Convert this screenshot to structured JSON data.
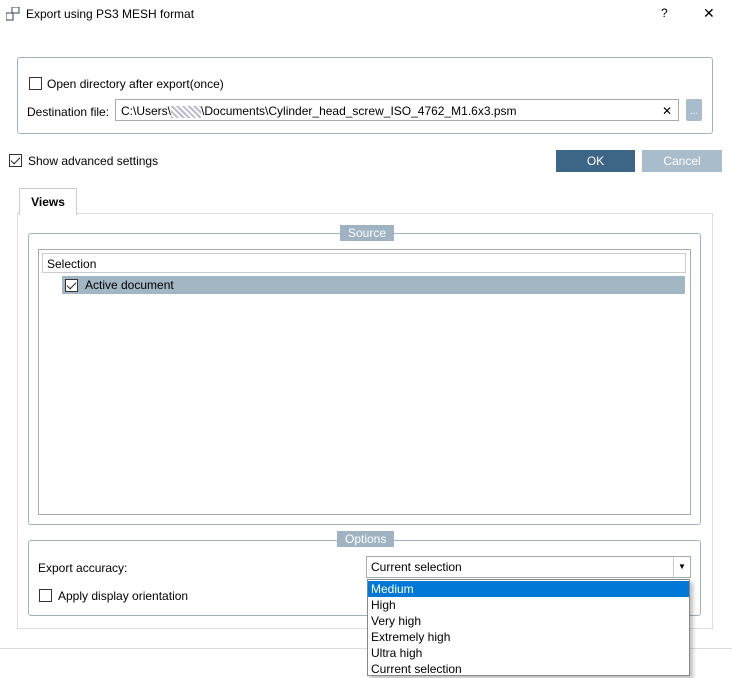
{
  "window": {
    "title": "Export using PS3 MESH format",
    "help": "?",
    "close": "✕"
  },
  "top": {
    "open_dir_label": "Open directory after export(once)",
    "open_dir_checked": false,
    "dest_label": "Destination file:",
    "dest_prefix": "C:\\Users\\",
    "dest_suffix": "\\Documents\\Cylinder_head_screw_ISO_4762_M1.6x3.psm",
    "clear": "✕",
    "browse": "..."
  },
  "advanced": {
    "label": "Show advanced settings",
    "checked": true
  },
  "buttons": {
    "ok": "OK",
    "cancel": "Cancel"
  },
  "tabs": [
    {
      "label": "Views"
    }
  ],
  "source": {
    "legend": "Source",
    "column": "Selection",
    "rows": [
      {
        "label": "Active document",
        "checked": true
      }
    ]
  },
  "options": {
    "legend": "Options",
    "accuracy_label": "Export accuracy:",
    "accuracy_value": "Current selection",
    "orientation_label": "Apply display orientation",
    "orientation_checked": false,
    "dropdown_items": [
      "Medium",
      "High",
      "Very high",
      "Extremely high",
      "Ultra high",
      "Current selection"
    ],
    "highlighted": "Medium"
  }
}
